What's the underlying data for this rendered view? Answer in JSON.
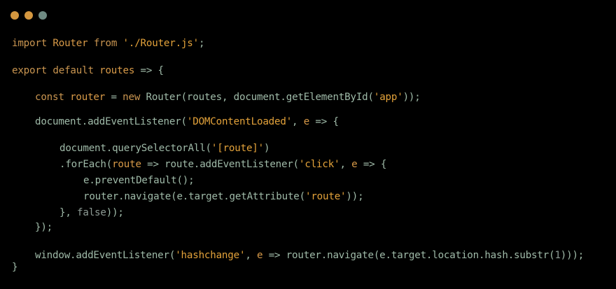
{
  "window": {
    "controls": [
      {
        "name": "close-dot",
        "color": "#d4973f"
      },
      {
        "name": "minimize-dot",
        "color": "#d4973f"
      },
      {
        "name": "maximize-dot",
        "color": "#6f8a83"
      }
    ]
  },
  "code": {
    "lines": [
      {
        "indent": 0,
        "tokens": [
          {
            "t": "import ",
            "c": "kw"
          },
          {
            "t": "Router ",
            "c": "id"
          },
          {
            "t": "from ",
            "c": "kw"
          },
          {
            "t": "'./Router.js'",
            "c": "str"
          },
          {
            "t": ";",
            "c": "plain"
          }
        ]
      },
      {
        "indent": 0,
        "tokens": [
          {
            "t": "export default ",
            "c": "kw"
          },
          {
            "t": "routes ",
            "c": "id"
          },
          {
            "t": "=> {",
            "c": "plain"
          }
        ]
      },
      {
        "indent": 1,
        "tokens": [
          {
            "t": "const ",
            "c": "kw"
          },
          {
            "t": "router ",
            "c": "id"
          },
          {
            "t": "= ",
            "c": "plain"
          },
          {
            "t": "new ",
            "c": "kw"
          },
          {
            "t": "Router(routes, document.getElementById(",
            "c": "plain"
          },
          {
            "t": "'app'",
            "c": "str"
          },
          {
            "t": "));",
            "c": "plain"
          }
        ]
      },
      {
        "indent": 1,
        "tokens": [
          {
            "t": "document.addEventListener(",
            "c": "plain"
          },
          {
            "t": "'DOMContentLoaded'",
            "c": "str"
          },
          {
            "t": ", ",
            "c": "plain"
          },
          {
            "t": "e ",
            "c": "id"
          },
          {
            "t": "=> {",
            "c": "plain"
          }
        ]
      },
      {
        "indent": 2,
        "tokens": [
          {
            "t": "document.querySelectorAll(",
            "c": "plain"
          },
          {
            "t": "'[route]'",
            "c": "str"
          },
          {
            "t": ")",
            "c": "plain"
          }
        ]
      },
      {
        "indent": 2,
        "tokens": [
          {
            "t": ".forEach(",
            "c": "plain"
          },
          {
            "t": "route ",
            "c": "id"
          },
          {
            "t": "=> route.addEventListener(",
            "c": "plain"
          },
          {
            "t": "'click'",
            "c": "str"
          },
          {
            "t": ", ",
            "c": "plain"
          },
          {
            "t": "e ",
            "c": "id"
          },
          {
            "t": "=> {",
            "c": "plain"
          }
        ]
      },
      {
        "indent": 3,
        "tokens": [
          {
            "t": "e.preventDefault();",
            "c": "plain"
          }
        ]
      },
      {
        "indent": 3,
        "tokens": [
          {
            "t": "router.navigate(e.target.getAttribute(",
            "c": "plain"
          },
          {
            "t": "'route'",
            "c": "str"
          },
          {
            "t": "));",
            "c": "plain"
          }
        ]
      },
      {
        "indent": 2,
        "tokens": [
          {
            "t": "}, ",
            "c": "plain"
          },
          {
            "t": "false",
            "c": "lit"
          },
          {
            "t": "));",
            "c": "plain"
          }
        ]
      },
      {
        "indent": 1,
        "tokens": [
          {
            "t": "});",
            "c": "plain"
          }
        ]
      },
      {
        "indent": 1,
        "tokens": [
          {
            "t": "window.addEventListener(",
            "c": "plain"
          },
          {
            "t": "'hashchange'",
            "c": "str"
          },
          {
            "t": ", ",
            "c": "plain"
          },
          {
            "t": "e ",
            "c": "id"
          },
          {
            "t": "=> router.navigate(e.target.location.hash.substr(",
            "c": "plain"
          },
          {
            "t": "1",
            "c": "lit"
          },
          {
            "t": ")));",
            "c": "plain"
          }
        ]
      },
      {
        "indent": 0,
        "tokens": [
          {
            "t": "}",
            "c": "plain"
          }
        ]
      }
    ]
  }
}
